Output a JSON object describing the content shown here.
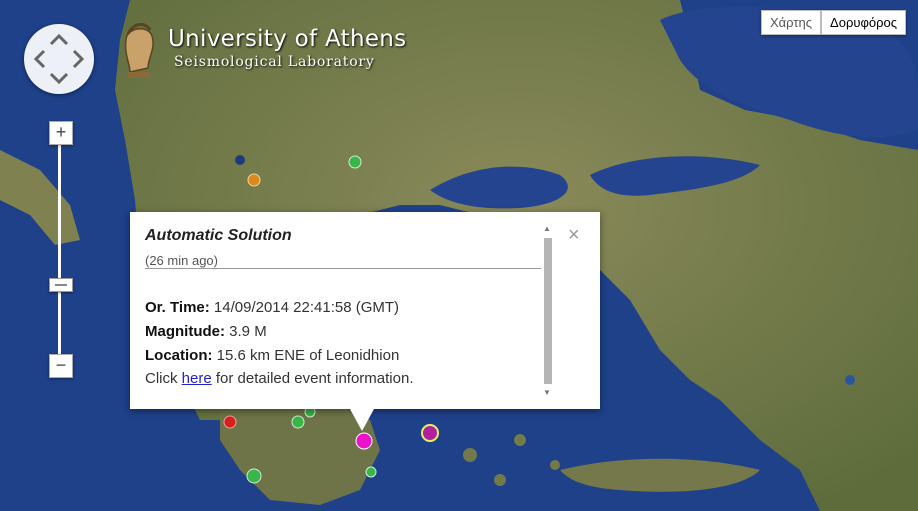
{
  "header": {
    "title": "University of Athens",
    "subtitle": "Seismological Laboratory"
  },
  "map_type": {
    "options": [
      "Χάρτης",
      "Δορυφόρος"
    ],
    "selected": "Δορυφόρος"
  },
  "zoom": {
    "in_label": "+",
    "out_label": "−"
  },
  "popup": {
    "title": "Automatic Solution",
    "age": "(26 min ago)",
    "origin_time_label": "Or. Time:",
    "origin_time": "14/09/2014 22:41:58 (GMT)",
    "magnitude_label": "Magnitude:",
    "magnitude": "3.9 M",
    "location_label": "Location:",
    "location": "15.6 km ENE of Leonidhion",
    "link_prefix": "Click",
    "link_text": "here",
    "link_suffix": "for detailed event information.",
    "close": "×"
  },
  "colors": {
    "sea": "#1d3f86",
    "land": "#6f7a48",
    "marker_latest": "#ee11cc",
    "marker_recent": "#d01090",
    "marker_green": "#39b54a",
    "marker_orange": "#d88a1e",
    "marker_red": "#d62020"
  }
}
